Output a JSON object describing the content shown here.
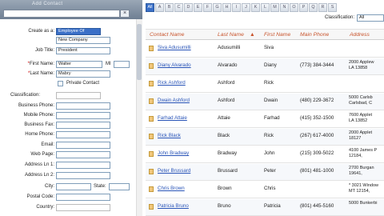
{
  "form": {
    "header_title": "Add Contact",
    "create_as_label": "Create as a:",
    "create_as_value": "Employee Of",
    "company_value": "New Company",
    "job_title_label": "Job Title:",
    "job_title_value": "President",
    "first_name_label": "First Name:",
    "first_name_value": "Walter",
    "mi_label": "MI",
    "last_name_label": "Last Name:",
    "last_name_value": "Mabry",
    "private_label": "Private Contact",
    "classification_label": "Classification:",
    "business_phone_label": "Business Phone:",
    "mobile_phone_label": "Mobile Phone:",
    "business_fax_label": "Business Fax:",
    "home_phone_label": "Home Phone:",
    "email_label": "Email:",
    "web_page_label": "Web Page:",
    "address1_label": "Address Ln 1:",
    "address2_label": "Address Ln 2:",
    "city_label": "City:",
    "state_label": "State:",
    "postal_label": "Postal Code:",
    "country_label": "Country:",
    "bottom_label": "...:"
  },
  "alphabet": [
    "All",
    "A",
    "B",
    "C",
    "D",
    "E",
    "F",
    "G",
    "H",
    "I",
    "J",
    "K",
    "L",
    "M",
    "N",
    "O",
    "P",
    "Q",
    "R",
    "S"
  ],
  "classification": {
    "label": "Classification:",
    "value": "All"
  },
  "columns": {
    "contact_name": "Contact Name",
    "last_name": "Last Name",
    "first_name": "First Name",
    "main_phone": "Main Phone",
    "address": "Address"
  },
  "rows": [
    {
      "name": "Siva Adusumilli",
      "last": "Adusumilli",
      "first": "Siva",
      "phone": "",
      "addr": ""
    },
    {
      "name": "Diany Alvarado",
      "last": "Alvarado",
      "first": "Diany",
      "phone": "(773) 384-3444",
      "addr": "2000 Applew\nLA 13858"
    },
    {
      "name": "Rick Ashford",
      "last": "Ashford",
      "first": "Rick",
      "phone": "",
      "addr": ""
    },
    {
      "name": "Dwain Ashford",
      "last": "Ashford",
      "first": "Dwain",
      "phone": "(480) 229-3672",
      "addr": "5000 Carlsb\nCarlsbad, C"
    },
    {
      "name": "Farhad Attaie",
      "last": "Attaie",
      "first": "Farhad",
      "phone": "(415) 352-1500",
      "addr": "7600 Applet\nLA 13852"
    },
    {
      "name": "Rick Black",
      "last": "Black",
      "first": "Rick",
      "phone": "(267) 617-4000",
      "addr": "2000 Applet\n18127"
    },
    {
      "name": "John Bradway",
      "last": "Bradway",
      "first": "John",
      "phone": "(215) 309-5022",
      "addr": "4100 James P\n12184,"
    },
    {
      "name": "Peter Brussard",
      "last": "Brussard",
      "first": "Peter",
      "phone": "(801) 481-1000",
      "addr": "2700 Burgan\n19641,"
    },
    {
      "name": "Chris Brown",
      "last": "Brown",
      "first": "Chris",
      "phone": "",
      "addr": "* 3021 Window\nMT 12154,"
    },
    {
      "name": "Patricia Bruno",
      "last": "Bruno",
      "first": "Patricia",
      "phone": "(801) 445-5160",
      "addr": "5000 Bunkerbi"
    }
  ]
}
